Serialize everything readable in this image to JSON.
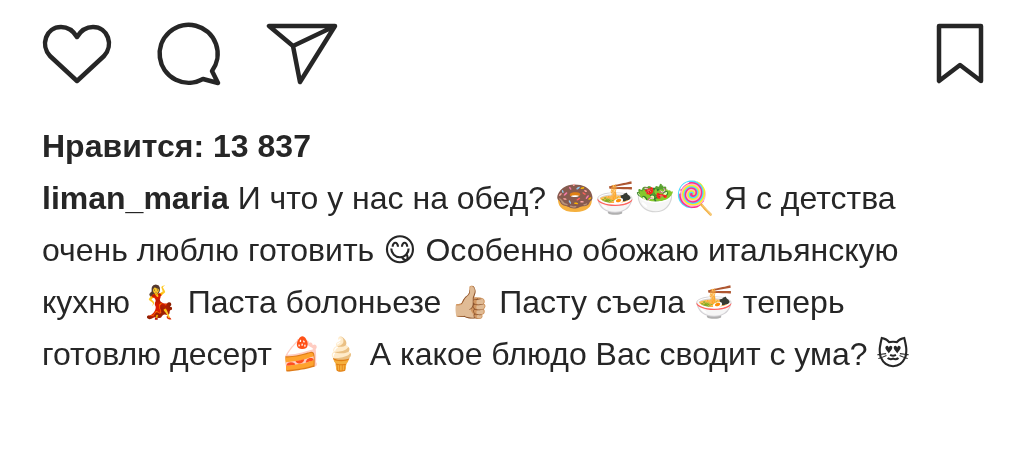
{
  "actions": {
    "liked": false,
    "saved": false
  },
  "likes": "Нравится: 13 837",
  "caption": {
    "username": "liman_maria",
    "text": "И что у нас на обед? 🍩🍜🥗🍭 Я с детства очень люблю готовить 😋 Особенно обожаю итальянскую кухню 💃 Паста болоньезе 👍🏼 Пасту съела 🍜 теперь готовлю десерт 🍰🍦 А какое блюдо Вас сводит с ума? 😻"
  }
}
